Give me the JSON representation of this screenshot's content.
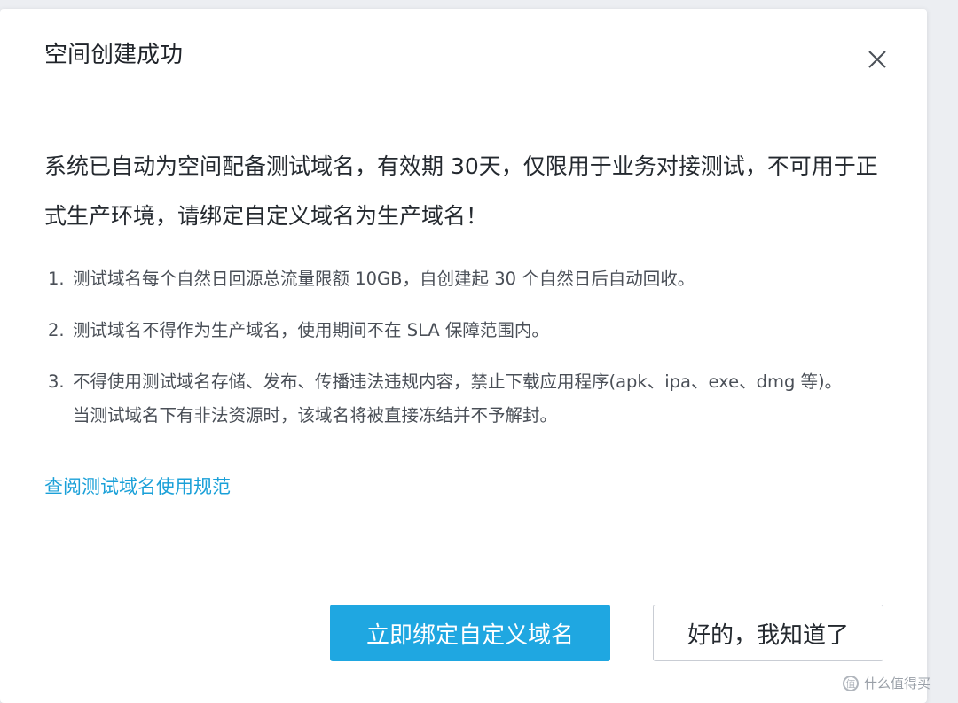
{
  "dialog": {
    "title": "空间创建成功",
    "close_icon": "close-icon"
  },
  "body": {
    "intro": "系统已自动为空间配备测试域名，有效期 30天，仅限用于业务对接测试，不可用于正式生产环境，请绑定自定义域名为生产域名！",
    "notes": [
      {
        "num": "1.",
        "text": "测试域名每个自然日回源总流量限额 10GB，自创建起 30 个自然日后自动回收。"
      },
      {
        "num": "2.",
        "text": "测试域名不得作为生产域名，使用期间不在 SLA 保障范围内。"
      },
      {
        "num": "3.",
        "text": "不得使用测试域名存储、发布、传播违法违规内容，禁止下载应用程序(apk、ipa、exe、dmg 等)。 当测试域名下有非法资源时，该域名将被直接冻结并不予解封。"
      }
    ],
    "doc_link": "查阅测试域名使用规范"
  },
  "footer": {
    "primary_label": "立即绑定自定义域名",
    "secondary_label": "好的，我知道了"
  },
  "watermark": {
    "text": "什么值得买",
    "logo_glyph": "值"
  },
  "colors": {
    "primary": "#1fa7e1",
    "link": "#1aa0d8",
    "backdrop": "#eceef2"
  }
}
